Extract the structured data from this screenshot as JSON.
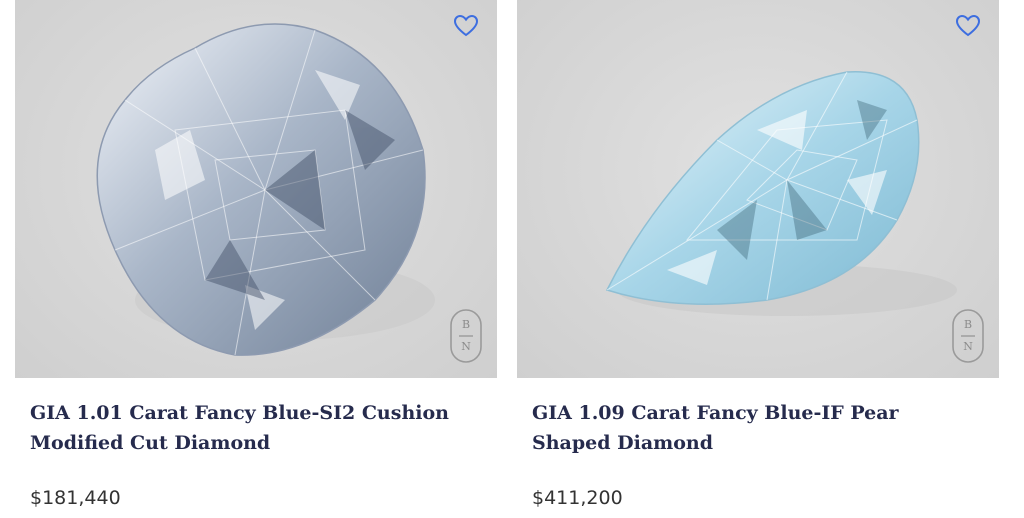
{
  "products": [
    {
      "title": "GIA 1.01 Carat Fancy Blue-SI2 Cushion Modified Cut Diamond",
      "price": "$181,440",
      "shape": "cushion",
      "badge_top": "B",
      "badge_bottom": "N"
    },
    {
      "title": "GIA 1.09 Carat Fancy Blue-IF Pear Shaped Diamond",
      "price": "$411,200",
      "shape": "pear",
      "badge_top": "B",
      "badge_bottom": "N"
    }
  ],
  "icons": {
    "wishlist": "heart-icon",
    "brand_badge": "brand-badge-icon"
  },
  "colors": {
    "heart": "#3d6ee0",
    "title": "#262b4d",
    "price": "#333333",
    "image_background": "#d9d9d9"
  }
}
